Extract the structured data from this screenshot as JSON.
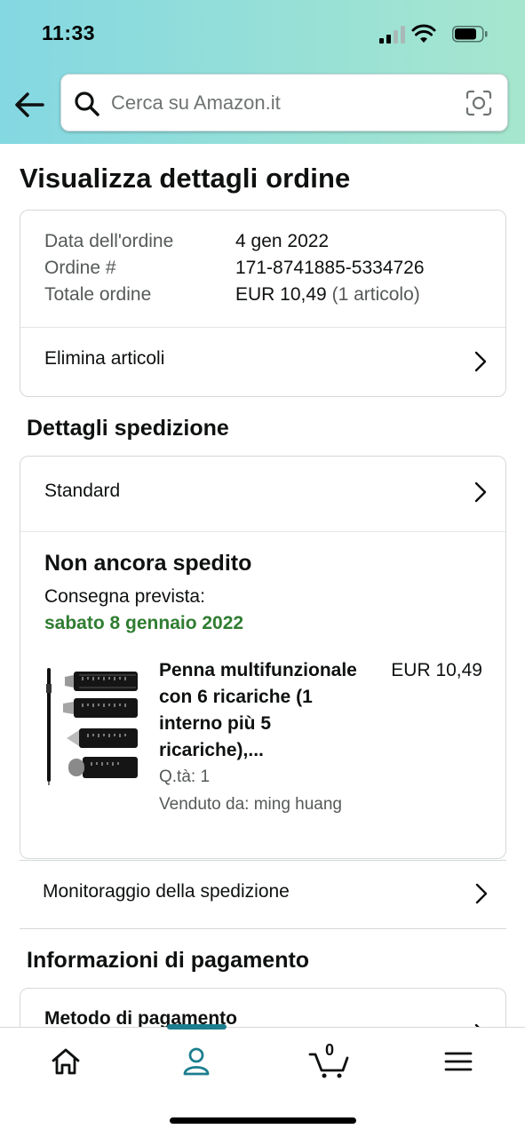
{
  "status_bar": {
    "time": "11:33"
  },
  "search": {
    "placeholder": "Cerca su Amazon.it"
  },
  "page": {
    "title": "Visualizza dettagli ordine"
  },
  "order_summary": {
    "date_label": "Data dell'ordine",
    "date_value": "4 gen 2022",
    "number_label": "Ordine #",
    "number_value": "171-8741885-5334726",
    "total_label": "Totale ordine",
    "total_value": "EUR 10,49",
    "total_items": "(1 articolo)",
    "delete_label": "Elimina articoli"
  },
  "shipping": {
    "section_title": "Dettagli spedizione",
    "method": "Standard",
    "status": "Non ancora spedito",
    "delivery_label": "Consegna prevista:",
    "delivery_date": "sabato 8 gennaio 2022",
    "delivery_date_color": "#2f7d31",
    "product": {
      "title": "Penna multifunzionale con 6 ricariche (1 interno più 5 ricariche),...",
      "price": "EUR 10,49",
      "quantity": "Q.tà: 1",
      "seller": "Venduto da: ming huang"
    },
    "tracking_label": "Monitoraggio della spedizione"
  },
  "payment": {
    "section_title": "Informazioni di pagamento",
    "method_label": "Metodo di pagamento"
  },
  "bottom_nav": {
    "active_item": "account",
    "accent_color": "#1d7e8f",
    "cart_count": "0",
    "items": [
      {
        "name": "home",
        "icon": "home-icon"
      },
      {
        "name": "account",
        "icon": "user-icon"
      },
      {
        "name": "cart",
        "icon": "cart-icon"
      },
      {
        "name": "menu",
        "icon": "menu-icon"
      }
    ]
  }
}
